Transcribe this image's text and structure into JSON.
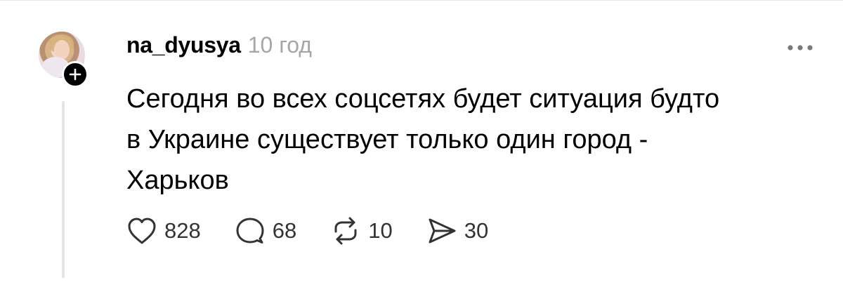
{
  "post": {
    "username": "na_dyusya",
    "timestamp": "10 год",
    "text": "Сегодня во всех соцсетях будет ситуация будто\nв Украине существует только один город -\nХарьков",
    "actions": {
      "likes": "828",
      "replies": "68",
      "reposts": "10",
      "shares": "30"
    }
  },
  "icons": {
    "follow": "plus-icon",
    "more": "more-horizontal-icon",
    "like": "heart-icon",
    "reply": "comment-icon",
    "repost": "repost-icon",
    "share": "send-icon"
  },
  "colors": {
    "text": "#000000",
    "muted": "#a6a6a6",
    "thread_line": "#e5e5e5",
    "icon": "#333333"
  }
}
